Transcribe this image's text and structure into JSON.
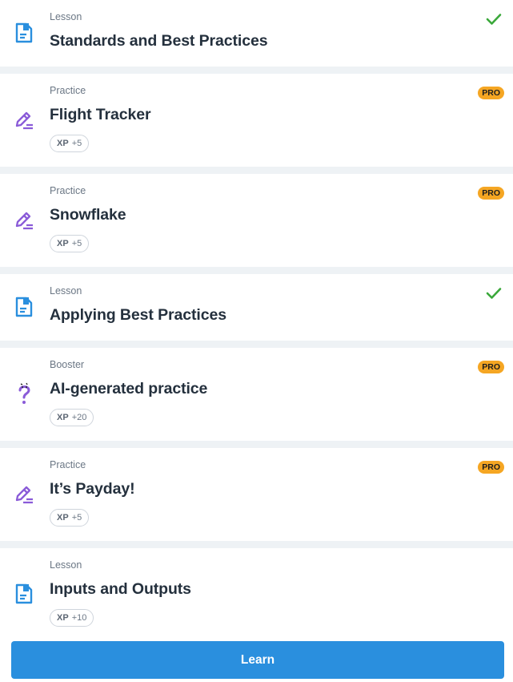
{
  "items": [
    {
      "type": "Lesson",
      "title": "Standards and Best Practices",
      "icon": "lesson-icon",
      "completed": true,
      "pro": false,
      "xp": null
    },
    {
      "type": "Practice",
      "title": "Flight Tracker",
      "icon": "practice-pencil-icon",
      "completed": false,
      "pro": true,
      "pro_label": "PRO",
      "xp_label": "XP",
      "xp": "+5"
    },
    {
      "type": "Practice",
      "title": "Snowflake",
      "icon": "practice-pencil-icon",
      "completed": false,
      "pro": true,
      "pro_label": "PRO",
      "xp_label": "XP",
      "xp": "+5"
    },
    {
      "type": "Lesson",
      "title": "Applying Best Practices",
      "icon": "lesson-icon",
      "completed": true,
      "pro": false,
      "xp": null
    },
    {
      "type": "Booster",
      "title": "AI-generated practice",
      "icon": "booster-question-icon",
      "completed": false,
      "pro": true,
      "pro_label": "PRO",
      "xp_label": "XP",
      "xp": "+20"
    },
    {
      "type": "Practice",
      "title": "It’s Payday!",
      "icon": "practice-pencil-icon",
      "completed": false,
      "pro": true,
      "pro_label": "PRO",
      "xp_label": "XP",
      "xp": "+5"
    },
    {
      "type": "Lesson",
      "title": "Inputs and Outputs",
      "icon": "lesson-icon",
      "completed": false,
      "pro": false,
      "xp_label": "XP",
      "xp": "+10"
    }
  ],
  "learn_button": {
    "label": "Learn"
  },
  "colors": {
    "lesson_icon": "#2a8fde",
    "practice_icon": "#8a5bd8",
    "check": "#3aa83a",
    "pro_badge": "#f5a623",
    "button": "#2a8fde"
  }
}
